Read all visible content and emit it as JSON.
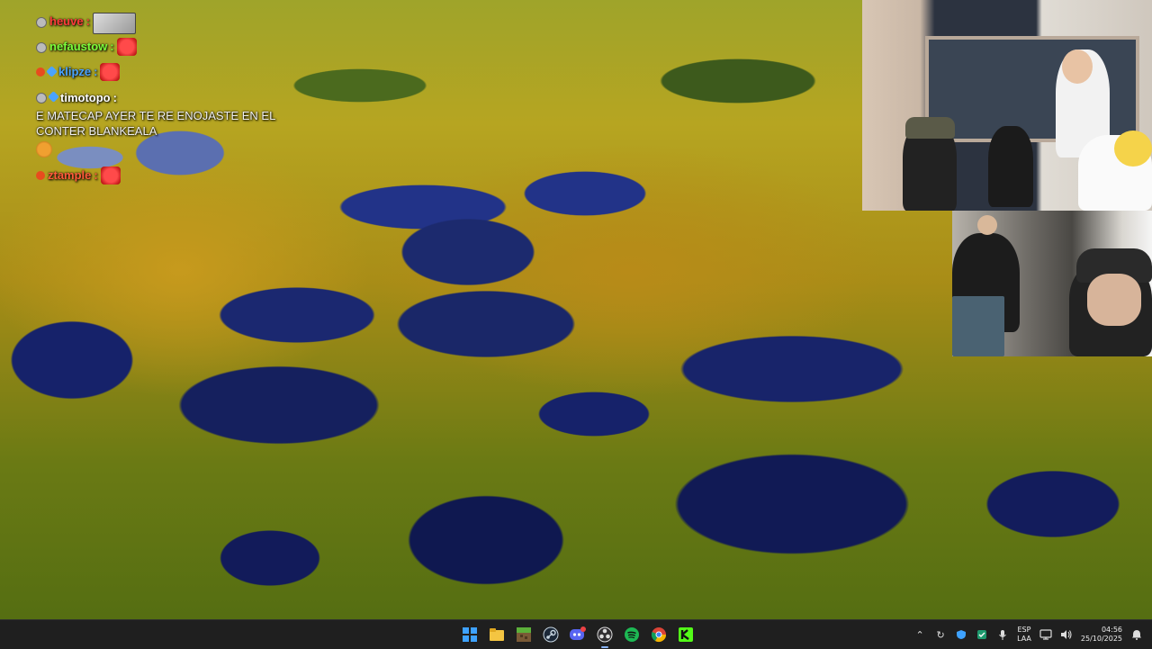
{
  "chat": {
    "messages": [
      {
        "username": "heuve",
        "username_color": "#ff3b3b",
        "badges": [
          "gray"
        ],
        "text": "",
        "emote": "image"
      },
      {
        "username": "nefaustow",
        "username_color": "#7cff3b",
        "badges": [
          "gray"
        ],
        "text": "",
        "emote": "red"
      },
      {
        "username": "klipze",
        "username_color": "#4aa3ff",
        "badges": [
          "red",
          "blue"
        ],
        "text": "",
        "emote": "red"
      },
      {
        "username": "timotopo",
        "username_color": "#ffffff",
        "badges": [
          "gray",
          "blue"
        ],
        "text": "E MATECAP AYER TE RE ENOJASTE EN EL CONTER BLANKEALA",
        "emote": "face"
      },
      {
        "username": "ztample",
        "username_color": "#ff5a3b",
        "badges": [
          "red"
        ],
        "text": "",
        "emote": "red"
      }
    ]
  },
  "taskbar": {
    "apps": [
      {
        "name": "windows-start",
        "icon": "windows-icon"
      },
      {
        "name": "file-explorer",
        "icon": "folder-icon"
      },
      {
        "name": "minecraft",
        "icon": "minecraft-icon"
      },
      {
        "name": "steam",
        "icon": "steam-icon"
      },
      {
        "name": "discord",
        "icon": "discord-icon",
        "badge": "2"
      },
      {
        "name": "obs",
        "icon": "obs-icon"
      },
      {
        "name": "spotify",
        "icon": "spotify-icon"
      },
      {
        "name": "chrome",
        "icon": "chrome-icon"
      },
      {
        "name": "kick",
        "icon": "kick-icon"
      }
    ],
    "language_top": "ESP",
    "language_bottom": "LAA",
    "time": "04:56",
    "date": "25/10/2025"
  },
  "colors": {
    "taskbar_bg": "#1f1f1f",
    "accent": "#3ea2ff"
  }
}
